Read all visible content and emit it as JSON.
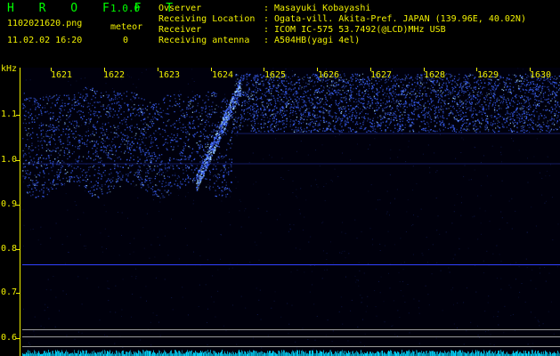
{
  "header": {
    "app_title": "H R O F F T",
    "app_version": "1.0.0",
    "file_name": "1102021620.png",
    "timestamp": "11.02.02 16:20",
    "meteor_label": "meteor",
    "meteor_count": "0"
  },
  "info": [
    {
      "key": "Ovserver",
      "sep": ":",
      "value": "Masayuki Kobayashi"
    },
    {
      "key": "Receiving Location",
      "sep": ":",
      "value": "Ogata-vill. Akita-Pref. JAPAN (139.96E, 40.02N)"
    },
    {
      "key": "Receiver",
      "sep": ":",
      "value": "ICOM IC-575 53.7492(@LCD)MHz USB"
    },
    {
      "key": "Receiving antenna",
      "sep": ":",
      "value": "A504HB(yagi 4el)"
    }
  ],
  "plot": {
    "y_unit": "kHz",
    "y_ticks": [
      "1.1",
      "1.0",
      "0.9",
      "0.8",
      "0.7",
      "0.6"
    ],
    "x_ticks": [
      "1621",
      "1622",
      "1623",
      "1624",
      "1625",
      "1626",
      "1627",
      "1628",
      "1629",
      "1630"
    ]
  },
  "colors": {
    "axis_text": "#f0f000",
    "title_green": "#00ff00",
    "signal_blue": "#3c64ff",
    "signal_bright": "#9fd4ff",
    "background": "#000000",
    "noise_cyan": "#00d8ff",
    "ref_line_blue": "#3040ff",
    "ref_line_gray": "#9a9a9a"
  }
}
